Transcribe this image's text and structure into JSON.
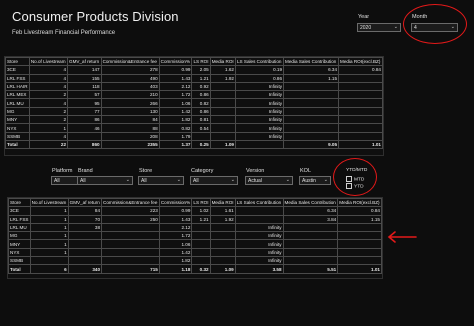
{
  "header": {
    "title": "Consumer Products Division",
    "subtitle": "Feb Livestream Financial Performance"
  },
  "top_slicers": {
    "year": {
      "label": "Year",
      "value": "2020"
    },
    "month": {
      "label": "Month",
      "value": "4"
    }
  },
  "table_columns": [
    "Store",
    "No.of Livestream",
    "GMV_af return",
    "Commission&Entrance fee",
    "Commission%",
    "LS ROI",
    "Media ROI",
    "LS Sales Contribution",
    "Media Sales Contribution",
    "Media ROI(excl.BZ)"
  ],
  "table1": {
    "rows": [
      [
        "3CE",
        "4",
        "147",
        "278",
        "0.99",
        "2.05",
        "1.62",
        "0.19",
        "6.34",
        "0.84"
      ],
      [
        "LRL FSS",
        "4",
        "155",
        "490",
        "1.43",
        "1.21",
        "1.92",
        "0.86",
        "1.15",
        ""
      ],
      [
        "LRL HAIR",
        "4",
        "118",
        "403",
        "2.12",
        "0.92",
        "",
        "Infinity",
        "",
        ""
      ],
      [
        "LRL MEX",
        "2",
        "57",
        "210",
        "1.72",
        "0.86",
        "",
        "Infinity",
        "",
        ""
      ],
      [
        "LRL MU",
        "4",
        "95",
        "266",
        "1.06",
        "0.82",
        "",
        "Infinity",
        "",
        ""
      ],
      [
        "MG",
        "2",
        "77",
        "130",
        "1.42",
        "0.86",
        "",
        "Infinity",
        "",
        ""
      ],
      [
        "MNY",
        "2",
        "86",
        "84",
        "1.82",
        "0.81",
        "",
        "Infinity",
        "",
        ""
      ],
      [
        "NYX",
        "1",
        "46",
        "88",
        "0.82",
        "0.54",
        "",
        "Infinity",
        "",
        ""
      ],
      [
        "SSMB",
        "4",
        "",
        "208",
        "1.79",
        "",
        "",
        "Infinity",
        "",
        ""
      ]
    ],
    "total": [
      "Total",
      "22",
      "860",
      "2355",
      "1.37",
      "0.25",
      "1.09",
      "",
      "9.05",
      "1.01"
    ]
  },
  "filters": {
    "platform": {
      "label": "Platform",
      "value": "All"
    },
    "brand": {
      "label": "Brand",
      "value": "All"
    },
    "store": {
      "label": "Store",
      "value": "All"
    },
    "category": {
      "label": "Category",
      "value": "All"
    },
    "version": {
      "label": "Version",
      "value": "Actual"
    },
    "kol": {
      "label": "KOL",
      "value": "Austin"
    },
    "ytd_mtd": {
      "label": "YTD/MTD",
      "options": [
        "MTD",
        "YTD"
      ]
    }
  },
  "table2": {
    "rows": [
      [
        "3CE",
        "1",
        "84",
        "223",
        "0.99",
        "1.02",
        "1.61",
        "",
        "6.34",
        "0.84"
      ],
      [
        "LRL FSS",
        "1",
        "70",
        "250",
        "1.43",
        "1.21",
        "1.92",
        "",
        "3.84",
        "1.15"
      ],
      [
        "LRL MU",
        "1",
        "38",
        "",
        "2.12",
        "",
        "",
        "Infinity",
        "",
        ""
      ],
      [
        "MG",
        "1",
        "",
        "",
        "1.72",
        "",
        "",
        "Infinity",
        "",
        ""
      ],
      [
        "MNY",
        "1",
        "",
        "",
        "1.06",
        "",
        "",
        "Infinity",
        "",
        ""
      ],
      [
        "NYX",
        "1",
        "",
        "",
        "1.42",
        "",
        "",
        "Infinity",
        "",
        ""
      ],
      [
        "SSMB",
        "",
        "",
        "",
        "1.82",
        "",
        "",
        "Infinity",
        "",
        ""
      ]
    ],
    "total": [
      "Total",
      "6",
      "340",
      "715",
      "1.18",
      "0.32",
      "1.09",
      "3.58",
      "5.51",
      "1.01"
    ]
  },
  "annotation_colors": {
    "highlight": "#e31919",
    "page_bg": "#0d0d0d"
  }
}
